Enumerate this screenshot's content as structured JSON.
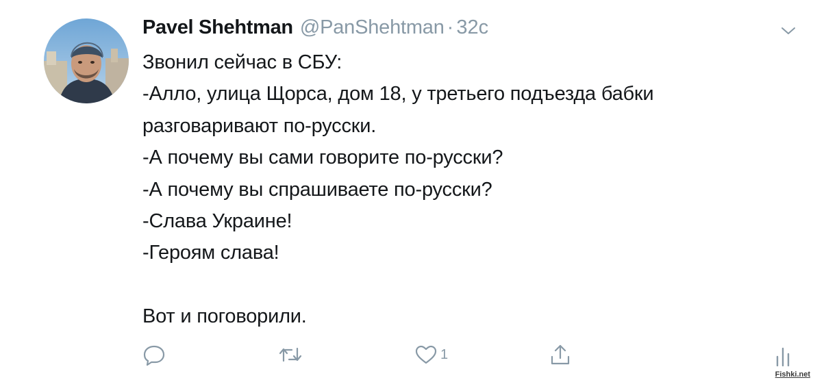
{
  "tweet": {
    "author": {
      "display_name": "Pavel Shehtman",
      "handle": "@PanShehtman",
      "separator": "·",
      "timestamp": "32с"
    },
    "body_lines": [
      "Звонил сейчас в СБУ:",
      "-Алло, улица Щорса, дом 18, у третьего подъезда бабки",
      "разговаривают по-русски.",
      "-А почему вы сами говорите по-русски?",
      "-А почему вы спрашиваете по-русски?",
      "-Слава Украине!",
      "-Героям слава!",
      "",
      "Вот и поговорили."
    ],
    "actions": {
      "reply_icon": "reply-icon",
      "retweet_icon": "retweet-icon",
      "like_icon": "like-icon",
      "like_count": "1",
      "share_icon": "share-icon",
      "analytics_icon": "analytics-icon"
    }
  },
  "watermark": "Fishki.net",
  "colors": {
    "text": "#14171a",
    "muted": "#8899a6",
    "icon": "#8899a6",
    "background": "#ffffff"
  }
}
